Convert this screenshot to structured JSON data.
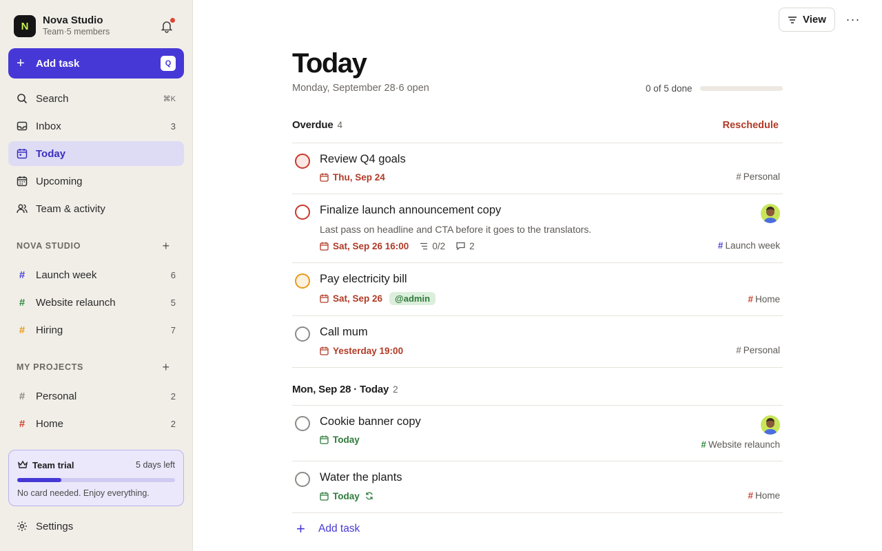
{
  "workspace": {
    "initial": "N",
    "name": "Nova Studio",
    "subtitle": "Team·5 members"
  },
  "sidebar": {
    "add_task": {
      "label": "Add task",
      "shortcut": "Q"
    },
    "nav": [
      {
        "label": "Search",
        "shortcut": "⌘K"
      },
      {
        "label": "Inbox",
        "count": "3"
      },
      {
        "label": "Today"
      },
      {
        "label": "Upcoming"
      },
      {
        "label": "Team & activity"
      }
    ],
    "team_section": {
      "title": "NOVA STUDIO",
      "projects": [
        {
          "name": "Launch week",
          "count": "6",
          "color": "#4a3fd8"
        },
        {
          "name": "Website relaunch",
          "count": "5",
          "color": "#2f8a3d"
        },
        {
          "name": "Hiring",
          "count": "7",
          "color": "#e59a18"
        }
      ]
    },
    "my_section": {
      "title": "MY PROJECTS",
      "projects": [
        {
          "name": "Personal",
          "count": "2",
          "color": "#8a8780"
        },
        {
          "name": "Home",
          "count": "2",
          "color": "#d0402f"
        }
      ]
    },
    "trial": {
      "title": "Team trial",
      "days_left": "5 days left",
      "note": "No card needed. Enjoy everything.",
      "progress": 0.28
    },
    "settings": {
      "label": "Settings"
    }
  },
  "topbar": {
    "view_label": "View",
    "more_label": "···"
  },
  "main": {
    "title": "Today",
    "subtitle": "Monday, September 28·6 open",
    "progress_text": "0 of 5 done",
    "progress": 0,
    "groups": [
      {
        "title": "Overdue",
        "count": "4",
        "action": "Reschedule",
        "tasks": [
          {
            "name": "Review Q4 goals",
            "due": "Thu, Sep 24",
            "project": "Personal",
            "project_color": "#8a8780",
            "priority": "p1"
          },
          {
            "name": "Finalize launch announcement copy",
            "description": "Last pass on headline and CTA before it goes to the translators.",
            "due": "Sat, Sep 26 16:00",
            "subtasks": "0/2",
            "comments": "2",
            "project": "Launch week",
            "project_color": "#4a3fd8",
            "priority": "p2"
          },
          {
            "name": "Pay electricity bill",
            "due": "Sat, Sep 26",
            "label": "@admin",
            "project": "Home",
            "project_color": "#d0402f",
            "priority": "p3"
          },
          {
            "name": "Call mum",
            "due": "Yesterday 19:00",
            "project": "Personal",
            "project_color": "#8a8780",
            "priority": "p4"
          }
        ]
      },
      {
        "title": "Mon, Sep 28 · Today",
        "count": "2",
        "tasks": [
          {
            "name": "Cookie banner copy",
            "due": "Today",
            "project": "Website relaunch",
            "project_color": "#2f8a3d",
            "priority": "p4"
          },
          {
            "name": "Water the plants",
            "due": "Today",
            "project": "Home",
            "project_color": "#d0402f",
            "priority": "p4"
          }
        ]
      }
    ],
    "add_task_label": "Add task"
  }
}
